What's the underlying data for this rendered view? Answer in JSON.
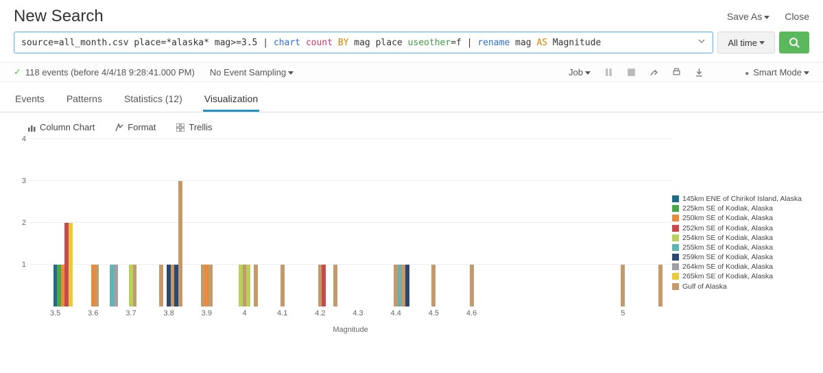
{
  "header": {
    "title": "New Search",
    "save_as": "Save As",
    "close": "Close"
  },
  "search": {
    "query_parts": {
      "p1": "source=all_month.csv place=*alaska* mag>=3.5 | ",
      "cmd1": "chart ",
      "fn1": "count ",
      "by": "BY ",
      "p2": "mag place ",
      "opt": "useother",
      "p3": "=f | ",
      "cmd2": "rename ",
      "p4": "mag ",
      "as": "AS ",
      "p5": "Magnitude"
    },
    "time_label": "All time"
  },
  "status": {
    "events_text": "118 events (before 4/4/18 9:28:41.000 PM)",
    "sampling": "No Event Sampling",
    "job": "Job",
    "smart_mode": "Smart Mode"
  },
  "tabs": {
    "events": "Events",
    "patterns": "Patterns",
    "statistics": "Statistics (12)",
    "visualization": "Visualization"
  },
  "viz_tools": {
    "column_chart": "Column Chart",
    "format": "Format",
    "trellis": "Trellis"
  },
  "chart_data": {
    "type": "bar",
    "xlabel": "Magnitude",
    "ylabel": "",
    "ylim": [
      0,
      4
    ],
    "y_ticks": [
      1,
      2,
      3,
      4
    ],
    "x_ticks": [
      3.5,
      3.6,
      3.7,
      3.8,
      3.9,
      4,
      4.1,
      4.2,
      4.3,
      4.4,
      4.5,
      4.6,
      5
    ],
    "x_range": [
      3.43,
      5.13
    ],
    "series": [
      {
        "name": "145km ENE of Chirikof Island, Alaska",
        "color": "#1e6b8c",
        "bars": [
          {
            "x": 3.5,
            "y": 1
          }
        ]
      },
      {
        "name": "225km SE of Kodiak, Alaska",
        "color": "#4aa84a",
        "bars": [
          {
            "x": 3.51,
            "y": 1
          }
        ]
      },
      {
        "name": "250km SE of Kodiak, Alaska",
        "color": "#e88c3c",
        "bars": [
          {
            "x": 3.52,
            "y": 1
          }
        ]
      },
      {
        "name": "252km SE of Kodiak, Alaska",
        "color": "#c94a4a",
        "bars": [
          {
            "x": 3.53,
            "y": 2
          }
        ]
      },
      {
        "name": "254km SE of Kodiak, Alaska",
        "color": "#b9cf5e",
        "bars": [
          {
            "x": 3.99,
            "y": 1
          }
        ]
      },
      {
        "name": "255km SE of Kodiak, Alaska",
        "color": "#5fb5b5",
        "bars": [
          {
            "x": 4.41,
            "y": 1
          }
        ]
      },
      {
        "name": "259km SE of Kodiak, Alaska",
        "color": "#2b4870",
        "bars": [
          {
            "x": 3.8,
            "y": 1
          }
        ]
      },
      {
        "name": "264km SE of Kodiak, Alaska",
        "color": "#a0a0a0",
        "bars": [
          {
            "x": 3.66,
            "y": 1
          }
        ]
      },
      {
        "name": "265km SE of Kodiak, Alaska",
        "color": "#e8c940",
        "bars": [
          {
            "x": 3.54,
            "y": 2
          }
        ]
      },
      {
        "name": "Gulf of Alaska",
        "color": "#c59a6a",
        "bars": [
          {
            "x": 3.61,
            "y": 1
          },
          {
            "x": 3.71,
            "y": 1
          },
          {
            "x": 3.78,
            "y": 1
          },
          {
            "x": 3.81,
            "y": 1
          },
          {
            "x": 3.83,
            "y": 3
          },
          {
            "x": 3.89,
            "y": 1
          },
          {
            "x": 3.91,
            "y": 1
          },
          {
            "x": 4.0,
            "y": 1
          },
          {
            "x": 4.03,
            "y": 1
          },
          {
            "x": 4.1,
            "y": 1
          },
          {
            "x": 4.2,
            "y": 1
          },
          {
            "x": 4.24,
            "y": 1
          },
          {
            "x": 4.4,
            "y": 1
          },
          {
            "x": 4.42,
            "y": 1
          },
          {
            "x": 4.5,
            "y": 1
          },
          {
            "x": 4.6,
            "y": 1
          },
          {
            "x": 5.0,
            "y": 1
          },
          {
            "x": 5.1,
            "y": 1
          }
        ]
      },
      {
        "name": "__extra_teal",
        "color": "#5fb5b5",
        "hidden_from_legend": true,
        "bars": [
          {
            "x": 3.65,
            "y": 1
          }
        ]
      },
      {
        "name": "__extra_orange",
        "color": "#e88c3c",
        "hidden_from_legend": true,
        "bars": [
          {
            "x": 3.6,
            "y": 1
          },
          {
            "x": 3.9,
            "y": 1
          }
        ]
      },
      {
        "name": "__extra_red",
        "color": "#c94a4a",
        "hidden_from_legend": true,
        "bars": [
          {
            "x": 4.21,
            "y": 1
          }
        ]
      },
      {
        "name": "__extra_lime",
        "color": "#b9cf5e",
        "hidden_from_legend": true,
        "bars": [
          {
            "x": 3.7,
            "y": 1
          },
          {
            "x": 4.01,
            "y": 1
          }
        ]
      },
      {
        "name": "__extra_navy",
        "color": "#2b4870",
        "hidden_from_legend": true,
        "bars": [
          {
            "x": 3.82,
            "y": 1
          },
          {
            "x": 4.43,
            "y": 1
          }
        ]
      }
    ]
  }
}
